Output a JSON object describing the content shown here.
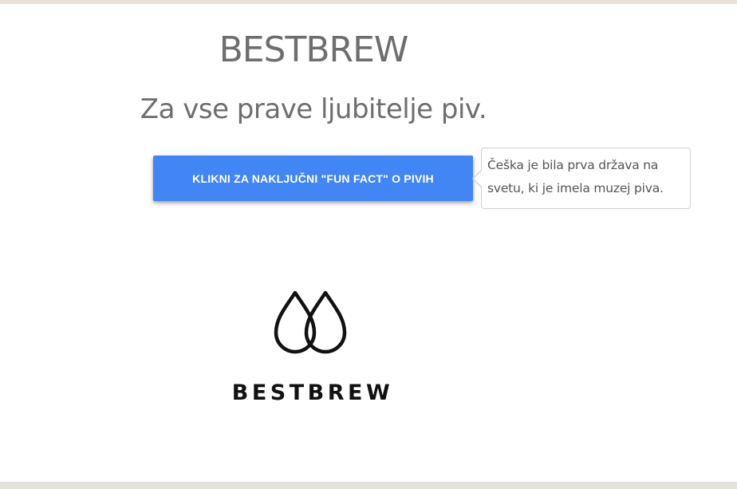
{
  "header": {
    "title": "BESTBREW",
    "subtitle": "Za vse prave ljubitelje piv."
  },
  "fun_fact_button": {
    "label": "KLIKNI ZA NAKLJUČNI \"FUN FACT\" O PIVIH"
  },
  "tooltip": {
    "text": "Češka je bila prva država na svetu, ki je imela muzej piva."
  },
  "logo": {
    "wordmark": "BESTBREW",
    "icon": "two-drops-icon"
  },
  "colors": {
    "button": "#4285f4",
    "heading": "#6e6e6e",
    "logo": "#111111"
  }
}
